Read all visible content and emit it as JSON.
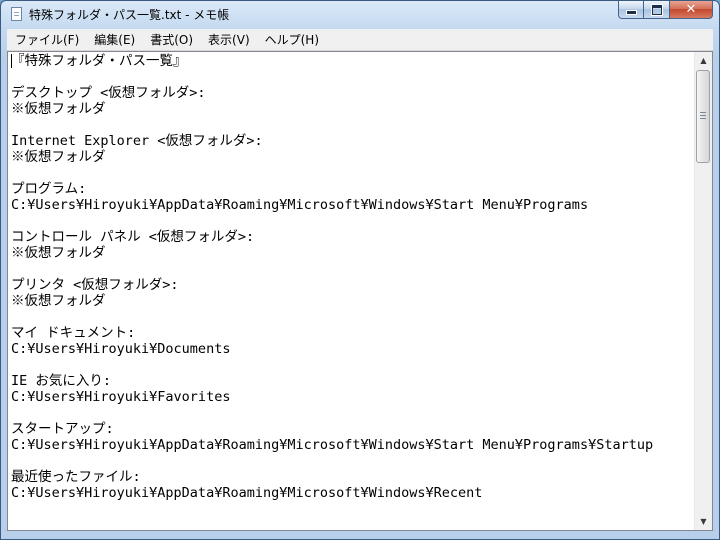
{
  "window": {
    "title": "特殊フォルダ・パス一覧.txt - メモ帳",
    "icon": "notepad-icon",
    "buttons": {
      "minimize": "minimize-icon",
      "maximize": "maximize-icon",
      "close": "close-icon",
      "close_glyph": "✕"
    }
  },
  "menu": [
    "ファイル(F)",
    "編集(E)",
    "書式(O)",
    "表示(V)",
    "ヘルプ(H)"
  ],
  "document": {
    "lines": [
      "『特殊フォルダ・パス一覧』",
      "",
      "デスクトップ <仮想フォルダ>:",
      "※仮想フォルダ",
      "",
      "Internet Explorer <仮想フォルダ>:",
      "※仮想フォルダ",
      "",
      "プログラム:",
      "C:¥Users¥Hiroyuki¥AppData¥Roaming¥Microsoft¥Windows¥Start Menu¥Programs",
      "",
      "コントロール パネル <仮想フォルダ>:",
      "※仮想フォルダ",
      "",
      "プリンタ <仮想フォルダ>:",
      "※仮想フォルダ",
      "",
      "マイ ドキュメント:",
      "C:¥Users¥Hiroyuki¥Documents",
      "",
      "IE お気に入り:",
      "C:¥Users¥Hiroyuki¥Favorites",
      "",
      "スタートアップ:",
      "C:¥Users¥Hiroyuki¥AppData¥Roaming¥Microsoft¥Windows¥Start Menu¥Programs¥Startup",
      "",
      "最近使ったファイル:",
      "C:¥Users¥Hiroyuki¥AppData¥Roaming¥Microsoft¥Windows¥Recent"
    ]
  },
  "scrollbar": {
    "up": "▲",
    "down": "▼",
    "position": 0
  },
  "colors": {
    "titlebar": "#c4d9f0",
    "close_button": "#c2482e",
    "editor_bg": "#ffffff"
  }
}
